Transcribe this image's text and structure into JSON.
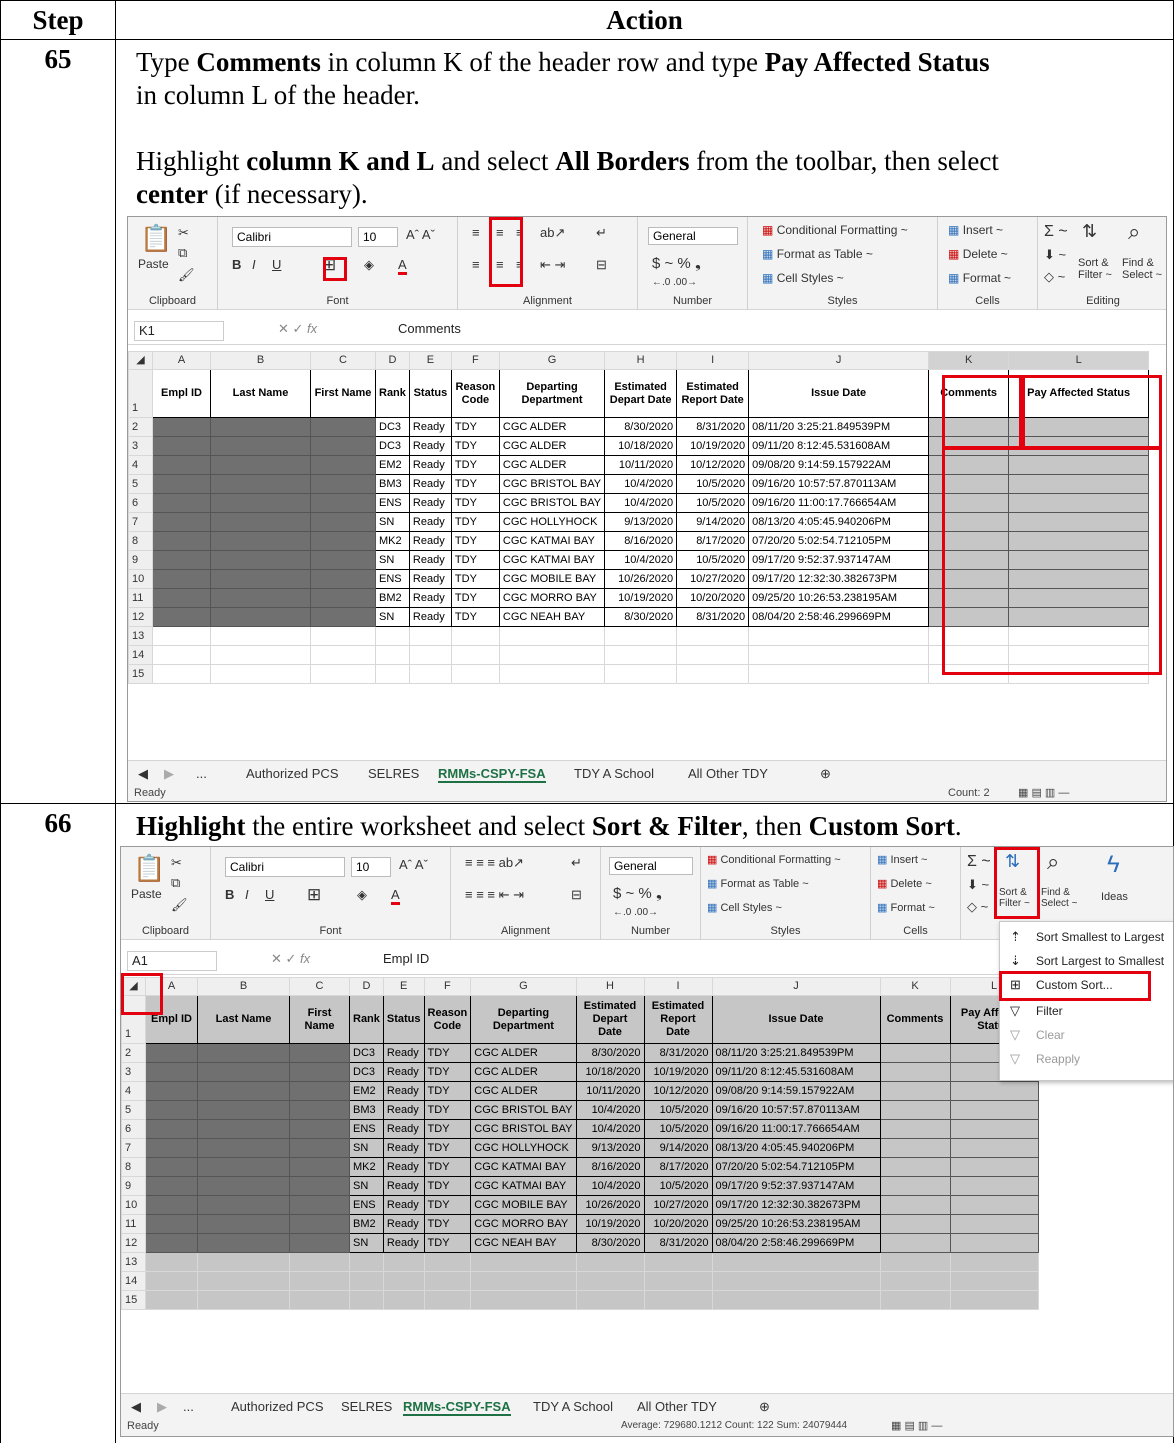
{
  "table": {
    "col_step": "Step",
    "col_action": "Action"
  },
  "step65": {
    "num": "65",
    "l1a": "Type ",
    "l1b": "Comments",
    "l1c": " in column K of the header row and type ",
    "l1d": "Pay Affected Status",
    "l2": "in column L of the header.",
    "l3a": "Highlight ",
    "l3b": "column K and L",
    "l3c": " and select ",
    "l3d": "All Borders",
    "l3e": " from the toolbar, then select",
    "l4a": "center",
    "l4b": " (if necessary)."
  },
  "step66": {
    "num": "66",
    "l1a": "Highlight",
    "l1b": " the entire worksheet and select ",
    "l1c": "Sort & Filter",
    "l1d": ", then ",
    "l1e": "Custom Sort",
    "l1f": "."
  },
  "ribbon": {
    "paste": "Paste",
    "font_name": "Calibri",
    "font_size": "10",
    "number_format": "General",
    "cond_format": "Conditional Formatting ~",
    "format_table": "Format as Table ~",
    "cell_styles": "Cell Styles ~",
    "insert": "Insert ~",
    "delete": "Delete ~",
    "format": "Format ~",
    "sort_filter": "Sort &",
    "sort_filter2": "Filter ~",
    "find_select": "Find &",
    "find_select2": "Select ~",
    "ideas": "Ideas",
    "groups": {
      "clipboard": "Clipboard",
      "font": "Font",
      "alignment": "Alignment",
      "number": "Number",
      "styles": "Styles",
      "cells": "Cells",
      "editing": "Editing"
    }
  },
  "sheet1": {
    "name_box": "K1",
    "formula": "Comments",
    "status": "Ready",
    "status_right": "Count: 2"
  },
  "sheet2": {
    "name_box": "A1",
    "formula": "Empl ID",
    "status": "Ready",
    "status_right": "Average: 729680.1212    Count: 122    Sum: 24079444"
  },
  "columns": [
    "A",
    "B",
    "C",
    "D",
    "E",
    "F",
    "G",
    "H",
    "I",
    "J",
    "K",
    "L"
  ],
  "headers": [
    "Empl ID",
    "Last Name",
    "First Name",
    "Rank",
    "Status",
    "Reason Code",
    "Departing Department",
    "Estimated Depart Date",
    "Estimated Report Date",
    "Issue Date",
    "Comments",
    "Pay Affected Status"
  ],
  "rows": [
    [
      "DC3",
      "Ready",
      "TDY",
      "CGC ALDER",
      "8/30/2020",
      "8/31/2020",
      "08/11/20 3:25:21.849539PM"
    ],
    [
      "DC3",
      "Ready",
      "TDY",
      "CGC ALDER",
      "10/18/2020",
      "10/19/2020",
      "09/11/20 8:12:45.531608AM"
    ],
    [
      "EM2",
      "Ready",
      "TDY",
      "CGC ALDER",
      "10/11/2020",
      "10/12/2020",
      "09/08/20 9:14:59.157922AM"
    ],
    [
      "BM3",
      "Ready",
      "TDY",
      "CGC BRISTOL BAY",
      "10/4/2020",
      "10/5/2020",
      "09/16/20 10:57:57.870113AM"
    ],
    [
      "ENS",
      "Ready",
      "TDY",
      "CGC BRISTOL BAY",
      "10/4/2020",
      "10/5/2020",
      "09/16/20 11:00:17.766654AM"
    ],
    [
      "SN",
      "Ready",
      "TDY",
      "CGC HOLLYHOCK",
      "9/13/2020",
      "9/14/2020",
      "08/13/20 4:05:45.940206PM"
    ],
    [
      "MK2",
      "Ready",
      "TDY",
      "CGC KATMAI BAY",
      "8/16/2020",
      "8/17/2020",
      "07/20/20 5:02:54.712105PM"
    ],
    [
      "SN",
      "Ready",
      "TDY",
      "CGC KATMAI BAY",
      "10/4/2020",
      "10/5/2020",
      "09/17/20 9:52:37.937147AM"
    ],
    [
      "ENS",
      "Ready",
      "TDY",
      "CGC MOBILE BAY",
      "10/26/2020",
      "10/27/2020",
      "09/17/20 12:32:30.382673PM"
    ],
    [
      "BM2",
      "Ready",
      "TDY",
      "CGC MORRO BAY",
      "10/19/2020",
      "10/20/2020",
      "09/25/20 10:26:53.238195AM"
    ],
    [
      "SN",
      "Ready",
      "TDY",
      "CGC NEAH BAY",
      "8/30/2020",
      "8/31/2020",
      "08/04/20 2:58:46.299669PM"
    ]
  ],
  "sheet_tabs": [
    "...",
    "Authorized PCS",
    "SELRES",
    "RMMs-CSPY-FSA",
    "TDY A School",
    "All Other TDY"
  ],
  "sort_menu": [
    "Sort Smallest to Largest",
    "Sort Largest to Smallest",
    "Custom Sort...",
    "Filter",
    "Clear",
    "Reapply"
  ],
  "colors": {
    "highlight": "#e3000f",
    "dark_cell": "#707070",
    "selected_gray": "#c6c6c6"
  }
}
